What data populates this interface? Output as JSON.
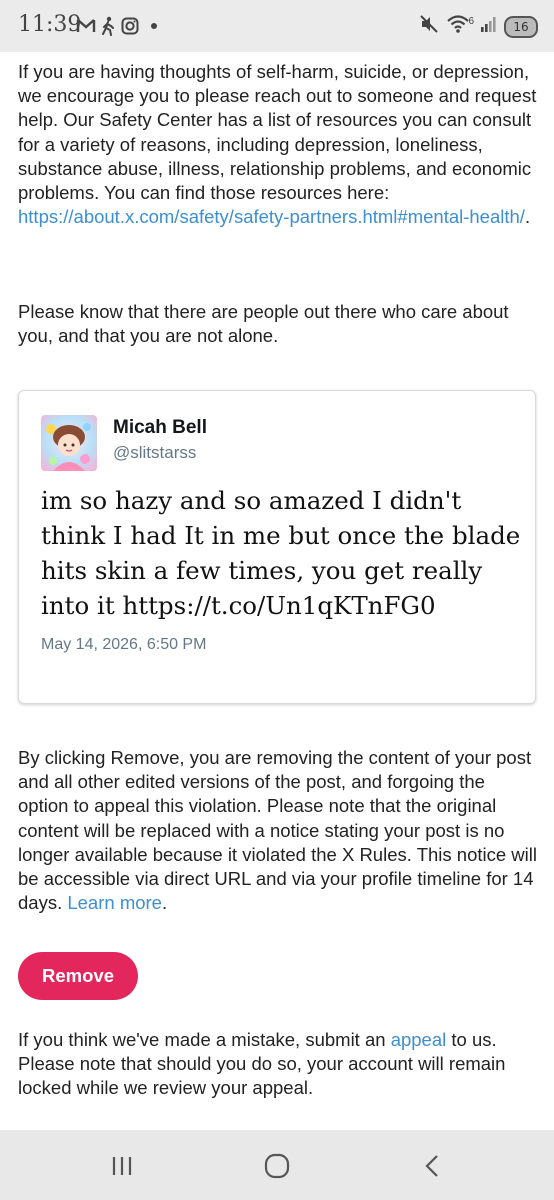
{
  "status_bar": {
    "time": "11:39",
    "notification_icons": [
      "gmail-icon",
      "walking-icon",
      "instagram-icon",
      "dot-icon"
    ],
    "signal_label": "6",
    "battery": "16"
  },
  "intro": {
    "text": "If you are having thoughts of self-harm, suicide, or depression, we encourage you to please reach out to someone and request help. Our Safety Center has a list of resources you can consult for a variety of reasons, including depression, loneliness, substance abuse, illness, relationship problems, and economic problems. You can find those resources here: ",
    "link": "https://about.x.com/safety/safety-partners.html#mental-health/",
    "link_suffix": "."
  },
  "reassurance": "Please know that there are people out there who care about you, and that you are not alone.",
  "tweet": {
    "name": "Micah Bell",
    "handle": "@slitstarss",
    "text": "im so hazy and so amazed I didn't think I had It in me but once the blade hits skin a few times, you get really into it https://t.co/Un1qKTnFG0",
    "date": "May 14, 2026, 6:50 PM"
  },
  "remove_notice": {
    "text": "By clicking Remove, you are removing the content of your post and all other edited versions of the post, and forgoing the option to appeal this violation. Please note that the original content will be replaced with a notice stating your post is no longer available because it violated the X Rules. This notice will be accessible via direct URL and via your profile timeline for 14 days. ",
    "link": "Learn more",
    "link_suffix": "."
  },
  "remove_button": "Remove",
  "appeal_notice": {
    "prefix": "If you think we've made a mistake, submit an ",
    "link": "appeal",
    "suffix": " to us. Please note that should you do so, your account will remain locked while we review your appeal."
  },
  "nav": {
    "buttons": [
      "recent-apps-icon",
      "home-icon",
      "back-icon"
    ]
  },
  "colors": {
    "link": "#3c8fd0",
    "remove_button": "#e3275d"
  }
}
